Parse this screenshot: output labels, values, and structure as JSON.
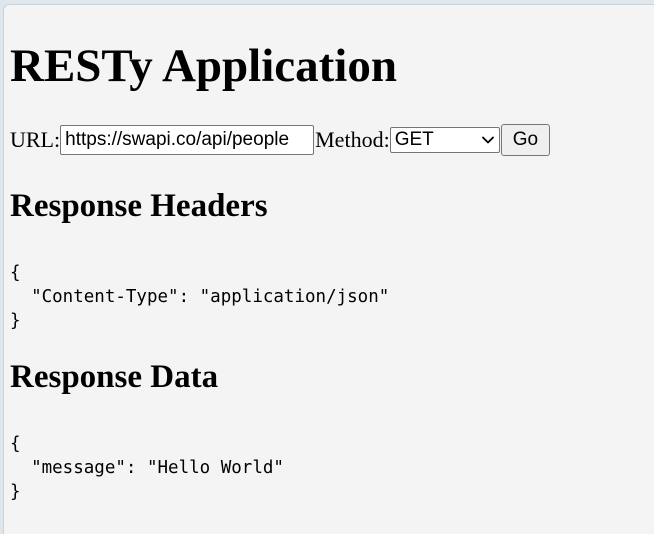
{
  "app": {
    "title": "RESTy Application"
  },
  "form": {
    "url_label": "URL:",
    "url_value": "https://swapi.co/api/people",
    "method_label": "Method:",
    "method_selected": "GET",
    "go_label": "Go"
  },
  "headers_section": {
    "title": "Response Headers",
    "lines": [
      "{",
      "  \"Content-Type\": \"application/json\"",
      "}"
    ]
  },
  "data_section": {
    "title": "Response Data",
    "lines": [
      "{",
      "  \"message\": \"Hello World\"",
      "}"
    ]
  },
  "icons": {
    "method_dropdown": "chevron-down-icon"
  }
}
